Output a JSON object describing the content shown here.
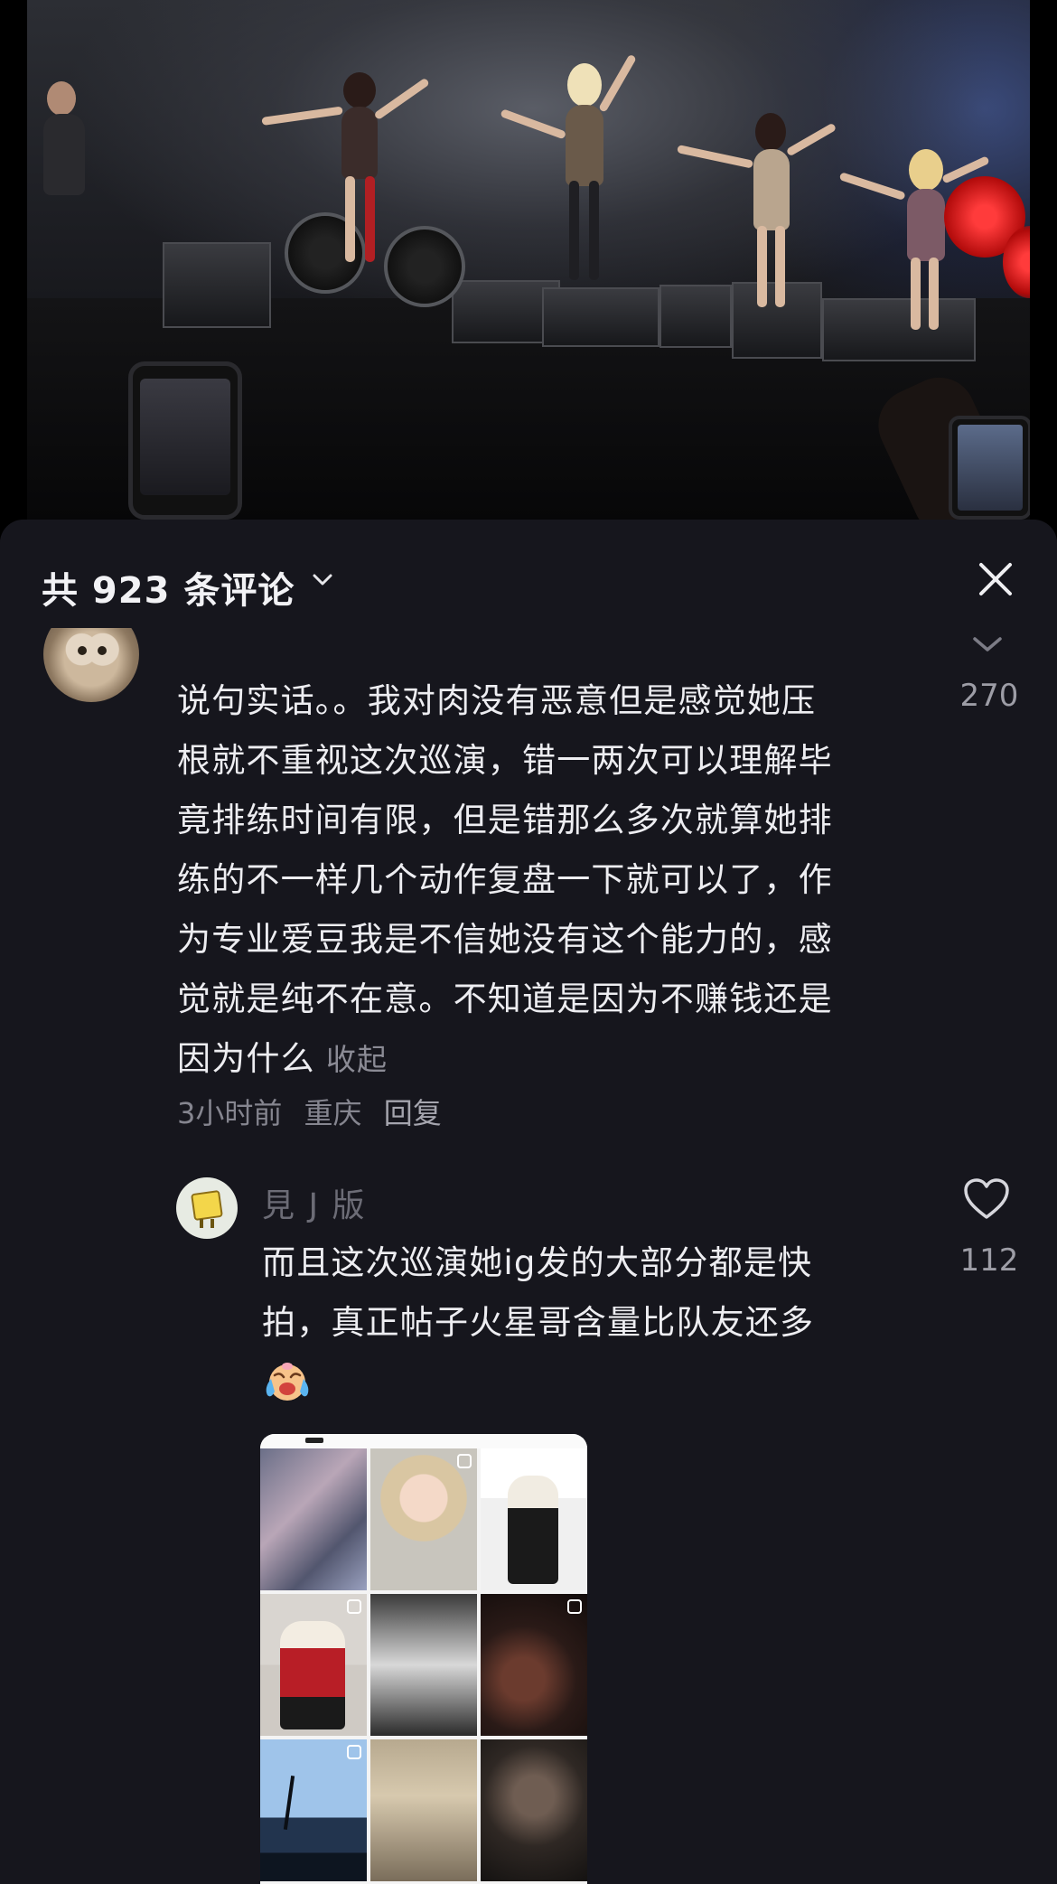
{
  "header": {
    "comment_count_label": "共 923 条评论",
    "close_icon": "close-icon",
    "dropdown_icon": "chevron-down-icon"
  },
  "comment": {
    "username_partial": "",
    "like_count": "270",
    "text_lines": [
      "说句实话。。我对肉没有恶意但是感觉她压",
      "根就不重视这次巡演，错一两次可以理解毕",
      "竟排练时间有限，但是错那么多次就算她排",
      "练的不一样几个动作复盘一下就可以了，作",
      "为专业爱豆我是不信她没有这个能力的，感",
      "觉就是纯不在意。不知道是因为不赚钱还是",
      "因为什么"
    ],
    "collapse_label": "收起",
    "time": "3小时前",
    "location": "重庆",
    "reply_label": "回复"
  },
  "reply": {
    "username": "見     J       版",
    "like_count": "112",
    "text_lines": [
      "而且这次巡演她ig发的大部分都是快",
      "拍，真正帖子火星哥含量比队友还多"
    ],
    "emoji": "crying-laughing-emoji"
  },
  "colors": {
    "sheet_background": "#16161d",
    "primary_text": "#ededf1",
    "secondary_text": "#85858f"
  }
}
